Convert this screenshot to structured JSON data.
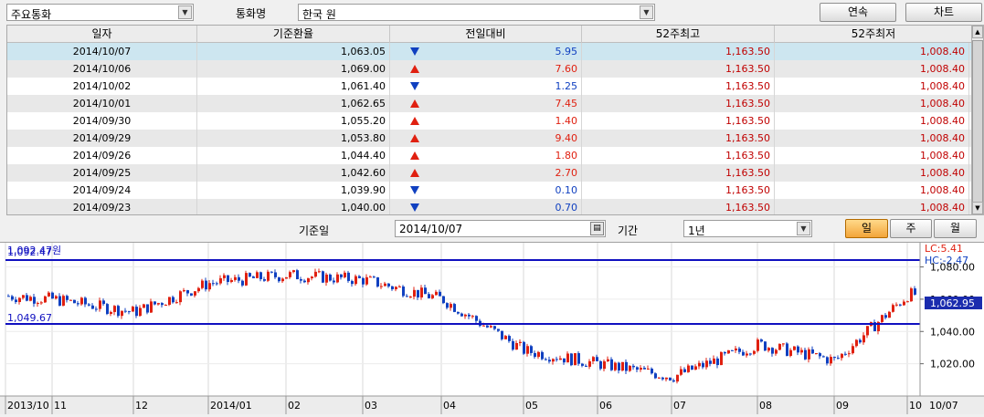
{
  "toolbar": {
    "category_value": "주요통화",
    "currency_label": "통화명",
    "currency_value": "한국 원",
    "continuous_button": "연속",
    "next_button": "차트"
  },
  "table": {
    "headers": [
      "일자",
      "기준환율",
      "전일대비",
      "52주최고",
      "52주최저"
    ],
    "rows": [
      {
        "date": "2014/10/07",
        "rate": "1,063.05",
        "dir": "down",
        "change": "5.95",
        "high": "1,163.50",
        "low": "1,008.40"
      },
      {
        "date": "2014/10/06",
        "rate": "1,069.00",
        "dir": "up",
        "change": "7.60",
        "high": "1,163.50",
        "low": "1,008.40"
      },
      {
        "date": "2014/10/02",
        "rate": "1,061.40",
        "dir": "down",
        "change": "1.25",
        "high": "1,163.50",
        "low": "1,008.40"
      },
      {
        "date": "2014/10/01",
        "rate": "1,062.65",
        "dir": "up",
        "change": "7.45",
        "high": "1,163.50",
        "low": "1,008.40"
      },
      {
        "date": "2014/09/30",
        "rate": "1,055.20",
        "dir": "up",
        "change": "1.40",
        "high": "1,163.50",
        "low": "1,008.40"
      },
      {
        "date": "2014/09/29",
        "rate": "1,053.80",
        "dir": "up",
        "change": "9.40",
        "high": "1,163.50",
        "low": "1,008.40"
      },
      {
        "date": "2014/09/26",
        "rate": "1,044.40",
        "dir": "up",
        "change": "1.80",
        "high": "1,163.50",
        "low": "1,008.40"
      },
      {
        "date": "2014/09/25",
        "rate": "1,042.60",
        "dir": "up",
        "change": "2.70",
        "high": "1,163.50",
        "low": "1,008.40"
      },
      {
        "date": "2014/09/24",
        "rate": "1,039.90",
        "dir": "down",
        "change": "0.10",
        "high": "1,163.50",
        "low": "1,008.40"
      },
      {
        "date": "2014/09/23",
        "rate": "1,040.00",
        "dir": "down",
        "change": "0.70",
        "high": "1,163.50",
        "low": "1,008.40"
      }
    ]
  },
  "controls": {
    "base_date_label": "기준일",
    "base_date_value": "2014/10/07",
    "period_label": "기간",
    "period_value": "1년",
    "day_button": "일",
    "week_button": "주",
    "month_button": "월"
  },
  "chart": {
    "top_left_label": "1,092.47원",
    "line_upper_label": "1,092.47",
    "line_lower_label": "1,049.67",
    "lc_label": "LC:5.41",
    "hc_label": "HC:-2.47",
    "current_value_label": "1,062.95",
    "y_ticks": [
      "1,080.00",
      "1,060.00",
      "1,040.00",
      "1,020.00"
    ],
    "x_labels": [
      "2013/10",
      "11",
      "12",
      "2014/01",
      "02",
      "03",
      "04",
      "05",
      "06",
      "07",
      "08",
      "09",
      "10"
    ],
    "x_end_label": "10/07"
  },
  "chart_data": {
    "type": "candlestick",
    "title": "",
    "xlabel": "",
    "ylabel": "",
    "ylim": [
      1000,
      1095
    ],
    "y_ticks": [
      1020,
      1040,
      1060,
      1080
    ],
    "horizontal_lines": [
      1092.47,
      1049.67
    ],
    "last_value": 1062.95,
    "monthly_close_approx": {
      "months": [
        "2013/10",
        "11",
        "12",
        "2014/01",
        "02",
        "03",
        "04",
        "05",
        "06",
        "07",
        "08",
        "09",
        "10"
      ],
      "values": [
        1062,
        1060,
        1052,
        1070,
        1075,
        1072,
        1060,
        1028,
        1020,
        1012,
        1032,
        1022,
        1063
      ]
    }
  }
}
